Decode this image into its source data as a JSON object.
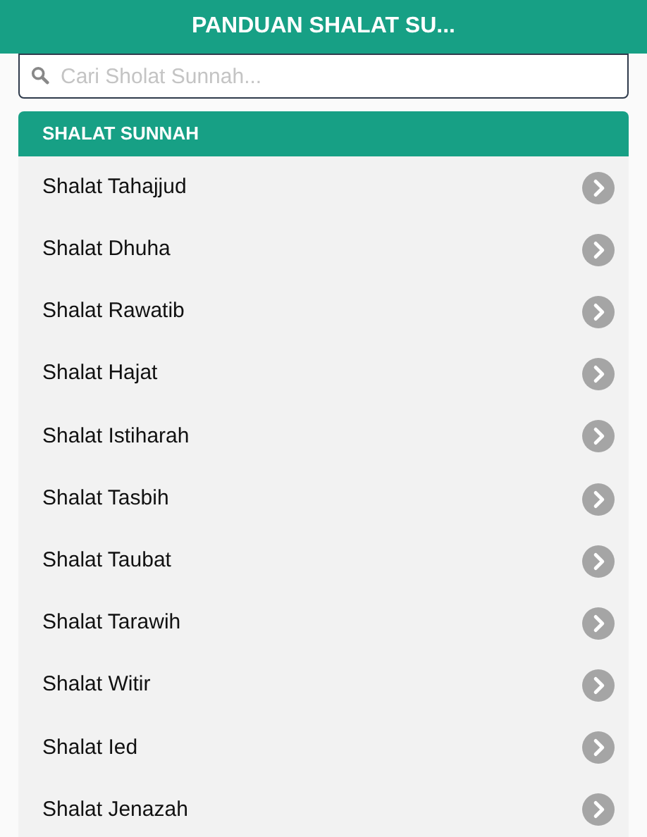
{
  "header": {
    "title": "PANDUAN SHALAT SU..."
  },
  "search": {
    "placeholder": "Cari Sholat Sunnah..."
  },
  "section": {
    "title": "SHALAT SUNNAH"
  },
  "items": [
    {
      "label": "Shalat Tahajjud"
    },
    {
      "label": "Shalat Dhuha"
    },
    {
      "label": "Shalat Rawatib"
    },
    {
      "label": "Shalat Hajat"
    },
    {
      "label": "Shalat Istiharah"
    },
    {
      "label": "Shalat Tasbih"
    },
    {
      "label": "Shalat Taubat"
    },
    {
      "label": "Shalat Tarawih"
    },
    {
      "label": "Shalat Witir"
    },
    {
      "label": "Shalat Ied"
    },
    {
      "label": "Shalat Jenazah"
    }
  ]
}
